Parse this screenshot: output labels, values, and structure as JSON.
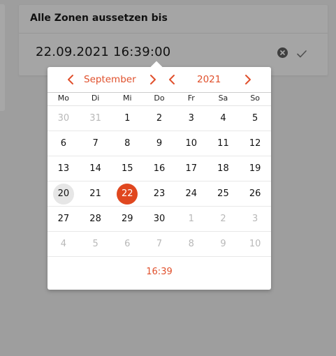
{
  "dialog": {
    "title": "Alle Zonen aussetzen bis",
    "value": "22.09.2021 16:39:00"
  },
  "picker": {
    "month_label": "September",
    "year_label": "2021",
    "time_label": "16:39",
    "weekdays": [
      "Mo",
      "Di",
      "Mi",
      "Do",
      "Fr",
      "Sa",
      "So"
    ],
    "weeks": [
      [
        {
          "d": "30",
          "m": true
        },
        {
          "d": "31",
          "m": true
        },
        {
          "d": "1"
        },
        {
          "d": "2"
        },
        {
          "d": "3"
        },
        {
          "d": "4"
        },
        {
          "d": "5"
        }
      ],
      [
        {
          "d": "6"
        },
        {
          "d": "7"
        },
        {
          "d": "8"
        },
        {
          "d": "9"
        },
        {
          "d": "10"
        },
        {
          "d": "11"
        },
        {
          "d": "12"
        }
      ],
      [
        {
          "d": "13"
        },
        {
          "d": "14"
        },
        {
          "d": "15"
        },
        {
          "d": "16"
        },
        {
          "d": "17"
        },
        {
          "d": "18"
        },
        {
          "d": "19"
        }
      ],
      [
        {
          "d": "20",
          "today": true
        },
        {
          "d": "21"
        },
        {
          "d": "22",
          "selected": true
        },
        {
          "d": "23"
        },
        {
          "d": "24"
        },
        {
          "d": "25"
        },
        {
          "d": "26"
        }
      ],
      [
        {
          "d": "27"
        },
        {
          "d": "28"
        },
        {
          "d": "29"
        },
        {
          "d": "30"
        },
        {
          "d": "1",
          "m": true
        },
        {
          "d": "2",
          "m": true
        },
        {
          "d": "3",
          "m": true
        }
      ],
      [
        {
          "d": "4",
          "m": true
        },
        {
          "d": "5",
          "m": true
        },
        {
          "d": "6",
          "m": true
        },
        {
          "d": "7",
          "m": true
        },
        {
          "d": "8",
          "m": true
        },
        {
          "d": "9",
          "m": true
        },
        {
          "d": "10",
          "m": true
        }
      ]
    ]
  },
  "colors": {
    "accent": "#e0502c",
    "selected": "#e0471f",
    "today_bg": "#e6e6e6",
    "overlay": "#9e9e9e"
  },
  "icons": {
    "clear": "close-circle-icon",
    "confirm": "check-icon",
    "prev": "chevron-left-icon",
    "next": "chevron-right-icon"
  }
}
